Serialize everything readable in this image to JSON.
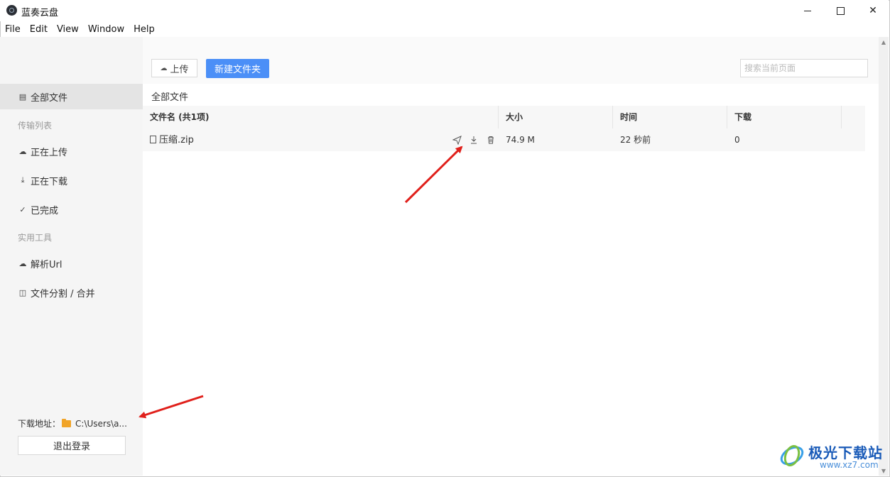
{
  "app": {
    "title": "蓝奏云盘"
  },
  "window_controls": {
    "minimize": "—",
    "maximize": "☐",
    "close": "✕"
  },
  "menu": [
    "File",
    "Edit",
    "View",
    "Window",
    "Help"
  ],
  "sidebar": {
    "items": [
      {
        "label": "全部文件",
        "icon": "file-icon",
        "active": true
      },
      {
        "label": "传输列表",
        "group": true
      },
      {
        "label": "正在上传",
        "icon": "upload-cloud-icon"
      },
      {
        "label": "正在下载",
        "icon": "download-icon"
      },
      {
        "label": "已完成",
        "icon": "check-circle-icon"
      },
      {
        "label": "实用工具",
        "group": true
      },
      {
        "label": "解析Url",
        "icon": "cloud-icon"
      },
      {
        "label": "文件分割 / 合并",
        "icon": "split-icon"
      }
    ],
    "download_path_label": "下载地址：",
    "download_path_value": "C:\\Users\\a...",
    "logout_label": "退出登录"
  },
  "toolbar": {
    "upload_label": "上传",
    "new_folder_label": "新建文件夹",
    "search_placeholder": "搜索当前页面",
    "accent_color": "#4b8ff7"
  },
  "breadcrumb": "全部文件",
  "table": {
    "columns": [
      "文件名 (共1项)",
      "大小",
      "时间",
      "下载"
    ],
    "rows": [
      {
        "name": "压缩.zip",
        "size": "74.9 M",
        "time": "22 秒前",
        "downloads": "0"
      }
    ]
  },
  "watermark": {
    "text": "极光下载站",
    "url": "www.xz7.com"
  }
}
